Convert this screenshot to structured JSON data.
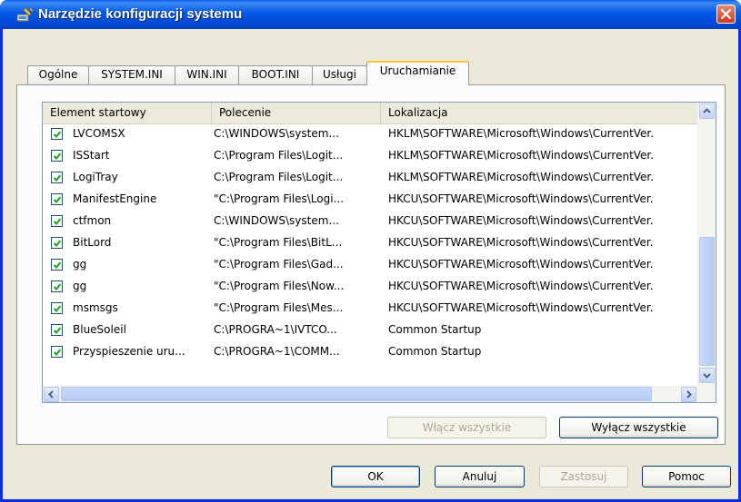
{
  "window": {
    "title": "Narzędzie konfiguracji systemu",
    "accent": "#0058e6",
    "close_icon": "close-icon"
  },
  "tabs": [
    {
      "label": "Ogólne"
    },
    {
      "label": "SYSTEM.INI"
    },
    {
      "label": "WIN.INI"
    },
    {
      "label": "BOOT.INI"
    },
    {
      "label": "Usługi"
    },
    {
      "label": "Uruchamianie",
      "active": true
    }
  ],
  "startup_list": {
    "columns": [
      "Element startowy",
      "Polecenie",
      "Lokalizacja"
    ],
    "rows": [
      {
        "checked": true,
        "item": "LVCOMSX",
        "command": "C:\\WINDOWS\\system...",
        "location": "HKLM\\SOFTWARE\\Microsoft\\Windows\\CurrentVer."
      },
      {
        "checked": true,
        "item": "ISStart",
        "command": "C:\\Program Files\\Logit...",
        "location": "HKLM\\SOFTWARE\\Microsoft\\Windows\\CurrentVer."
      },
      {
        "checked": true,
        "item": "LogiTray",
        "command": "C:\\Program Files\\Logit...",
        "location": "HKLM\\SOFTWARE\\Microsoft\\Windows\\CurrentVer."
      },
      {
        "checked": true,
        "item": "ManifestEngine",
        "command": "\"C:\\Program Files\\Logi...",
        "location": "HKCU\\SOFTWARE\\Microsoft\\Windows\\CurrentVer."
      },
      {
        "checked": true,
        "item": "ctfmon",
        "command": "C:\\WINDOWS\\system...",
        "location": "HKCU\\SOFTWARE\\Microsoft\\Windows\\CurrentVer."
      },
      {
        "checked": true,
        "item": "BitLord",
        "command": "\"C:\\Program Files\\BitL...",
        "location": "HKCU\\SOFTWARE\\Microsoft\\Windows\\CurrentVer."
      },
      {
        "checked": true,
        "item": "gg",
        "command": "\"C:\\Program Files\\Gad...",
        "location": "HKCU\\SOFTWARE\\Microsoft\\Windows\\CurrentVer."
      },
      {
        "checked": true,
        "item": "gg",
        "command": "\"C:\\Program Files\\Now...",
        "location": "HKCU\\SOFTWARE\\Microsoft\\Windows\\CurrentVer."
      },
      {
        "checked": true,
        "item": "msmsgs",
        "command": "\"C:\\Program Files\\Mes...",
        "location": "HKCU\\SOFTWARE\\Microsoft\\Windows\\CurrentVer."
      },
      {
        "checked": true,
        "item": "BlueSoleil",
        "command": "C:\\PROGRA~1\\IVTCO...",
        "location": "Common Startup"
      },
      {
        "checked": true,
        "item": "Przyspieszenie uru...",
        "command": "C:\\PROGRA~1\\COMM...",
        "location": "Common Startup"
      }
    ]
  },
  "actions": {
    "enable_all": "Włącz wszystkie",
    "disable_all": "Wyłącz wszystkie"
  },
  "dialog_buttons": {
    "ok": "OK",
    "cancel": "Anuluj",
    "apply": "Zastosuj",
    "help": "Pomoc"
  }
}
